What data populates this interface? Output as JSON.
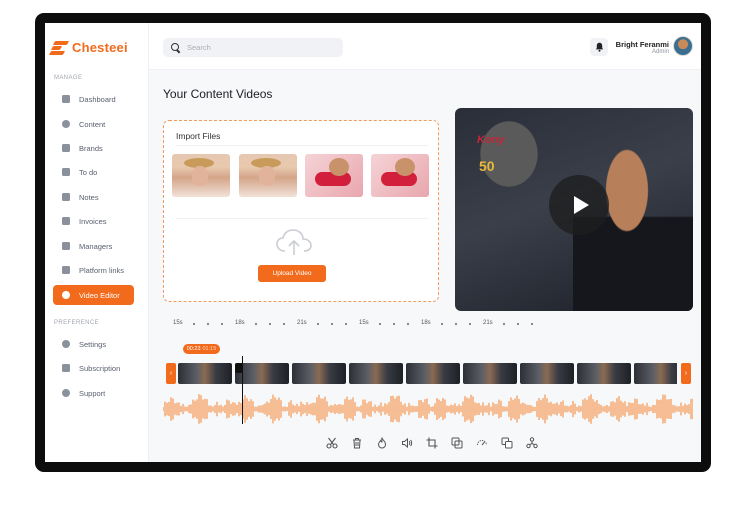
{
  "app": {
    "name": "Chesteei"
  },
  "sidebar": {
    "manage_label": "MANAGE",
    "preference_label": "PREFERENCE",
    "items": [
      {
        "label": "Dashboard",
        "icon": "dashboard-icon"
      },
      {
        "label": "Content",
        "icon": "content-icon"
      },
      {
        "label": "Brands",
        "icon": "brands-icon"
      },
      {
        "label": "To do",
        "icon": "todo-icon"
      },
      {
        "label": "Notes",
        "icon": "notes-icon"
      },
      {
        "label": "Invoices",
        "icon": "invoices-icon"
      },
      {
        "label": "Managers",
        "icon": "managers-icon"
      },
      {
        "label": "Platform links",
        "icon": "platform-links-icon"
      },
      {
        "label": "Video Editor",
        "icon": "video-editor-icon",
        "active": true
      }
    ],
    "preference_items": [
      {
        "label": "Settings",
        "icon": "settings-icon"
      },
      {
        "label": "Subscription",
        "icon": "subscription-icon"
      },
      {
        "label": "Support",
        "icon": "support-icon"
      }
    ]
  },
  "header": {
    "search_placeholder": "Search",
    "user": {
      "name": "Bright Feranmi",
      "role": "Admin"
    }
  },
  "main": {
    "title": "Your Content Videos",
    "import": {
      "title": "Import Files",
      "upload_label": "Upload Video"
    },
    "video": {
      "trophy_logo": "Kony",
      "trophy_number": "50"
    }
  },
  "timeline": {
    "ruler_labels": [
      "15s",
      "18s",
      "21s",
      "15s",
      "18s",
      "21s"
    ],
    "current_time": "00:23",
    "total_time": "01:15",
    "prev_label": "‹",
    "next_label": "›",
    "frame_count": 9
  },
  "toolbar": {
    "tools": [
      "scissors-icon",
      "trash-icon",
      "fire-icon",
      "volume-icon",
      "crop-icon",
      "duplicate-icon",
      "speed-icon",
      "layers-icon",
      "share-icon"
    ]
  },
  "colors": {
    "accent": "#f26b1d",
    "waveform": "#f5a468"
  }
}
